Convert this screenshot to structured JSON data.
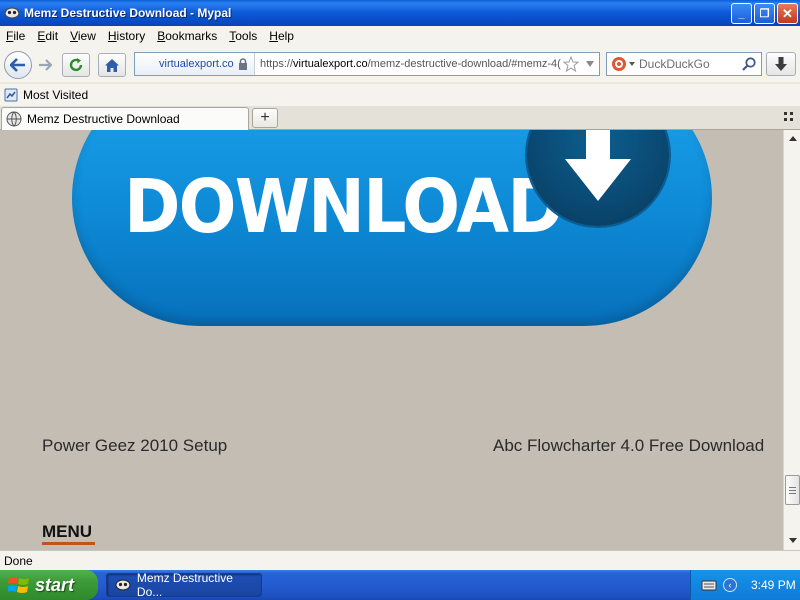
{
  "window": {
    "title": "Memz Destructive Download - Mypal",
    "minimize": "_",
    "maximize": "❐",
    "close": "✕"
  },
  "menu": [
    {
      "label": "File",
      "key": "F",
      "rest": "ile"
    },
    {
      "label": "Edit",
      "key": "E",
      "rest": "dit"
    },
    {
      "label": "View",
      "key": "V",
      "rest": "iew"
    },
    {
      "label": "History",
      "key": "H",
      "rest": "istory"
    },
    {
      "label": "Bookmarks",
      "key": "B",
      "rest": "ookmarks"
    },
    {
      "label": "Tools",
      "key": "T",
      "rest": "ools"
    },
    {
      "label": "Help",
      "key": "H",
      "rest": "elp"
    }
  ],
  "address": {
    "site_identity": "virtualexport.co",
    "url_scheme": "https://",
    "url_host": "virtualexport.co",
    "url_path": "/memz-destructive-download/#memz-4("
  },
  "search": {
    "placeholder": "DuckDuckGo"
  },
  "bookmarks": {
    "most_visited": "Most Visited"
  },
  "tab": {
    "title": "Memz Destructive Download",
    "new_tab": "+"
  },
  "content": {
    "banner_text": "DOWNLOAD",
    "link_left": "Power Geez 2010 Setup",
    "link_right": "Abc Flowcharter 4.0 Free Download",
    "menu_heading": "MENU"
  },
  "status": {
    "text": "Done"
  },
  "taskbar": {
    "start": "start",
    "task": "Memz Destructive Do...",
    "clock": "3:49 PM"
  },
  "colors": {
    "banner_blue": "#0e8ad6",
    "page_bg": "#c3bdb3",
    "menu_underline": "#c0541e"
  }
}
